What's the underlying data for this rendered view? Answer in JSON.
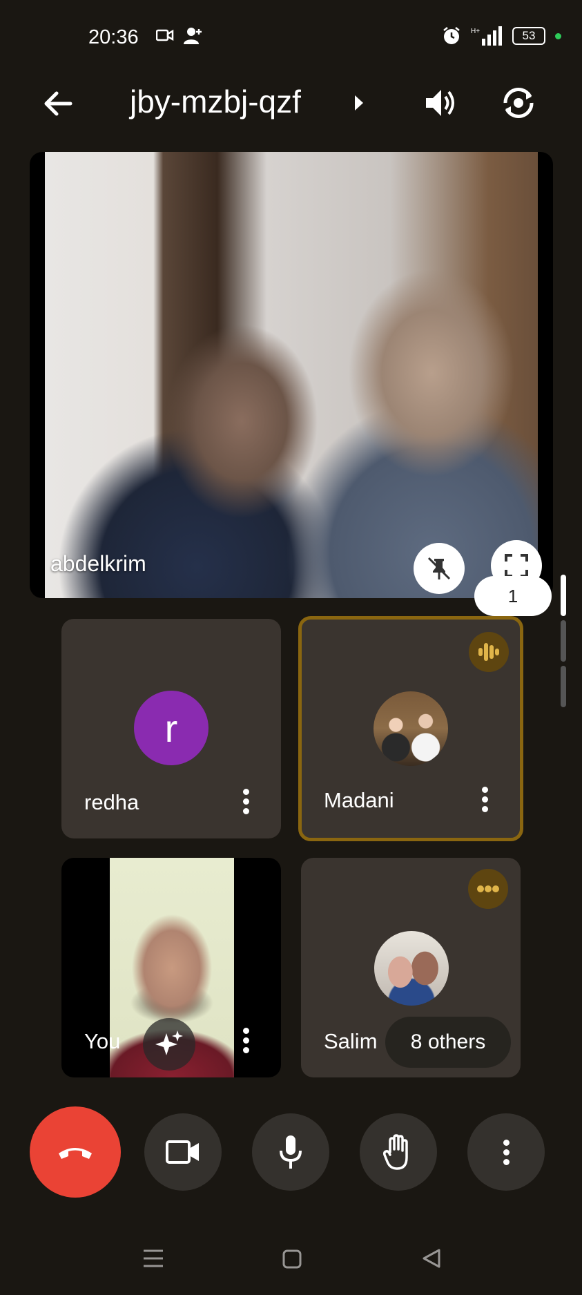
{
  "status_bar": {
    "time": "20:36",
    "battery": "53",
    "icons": [
      "video-call-icon",
      "add-person-icon",
      "alarm-icon",
      "signal-icon",
      "battery-icon"
    ]
  },
  "header": {
    "meeting_code": "jby-mzbj-qzf",
    "icons": [
      "back-arrow-icon",
      "chevron-right-icon",
      "speaker-icon",
      "switch-camera-icon"
    ]
  },
  "main_tile": {
    "participant_name": "abdelkrim",
    "icons": [
      "unpin-icon",
      "fullscreen-icon"
    ],
    "stack_count": "1"
  },
  "tiles": [
    {
      "name": "redha",
      "avatar_letter": "r",
      "avatar_color": "#8a2bb0"
    },
    {
      "name": "Madani",
      "speaking": true,
      "highlight_color": "#8a6610"
    },
    {
      "name": "You",
      "effects_icon": "sparkle-icon"
    },
    {
      "name": "Salim",
      "others_label": "8 others"
    }
  ],
  "controls": [
    "end-call-icon",
    "camera-icon",
    "microphone-icon",
    "raise-hand-icon",
    "more-options-icon"
  ],
  "nav_bar": [
    "menu-icon",
    "home-icon",
    "back-icon"
  ],
  "colors": {
    "background": "#1a1712",
    "tile": "#3a342f",
    "end_call": "#ea4335",
    "speaking_ring": "#8a6610"
  }
}
